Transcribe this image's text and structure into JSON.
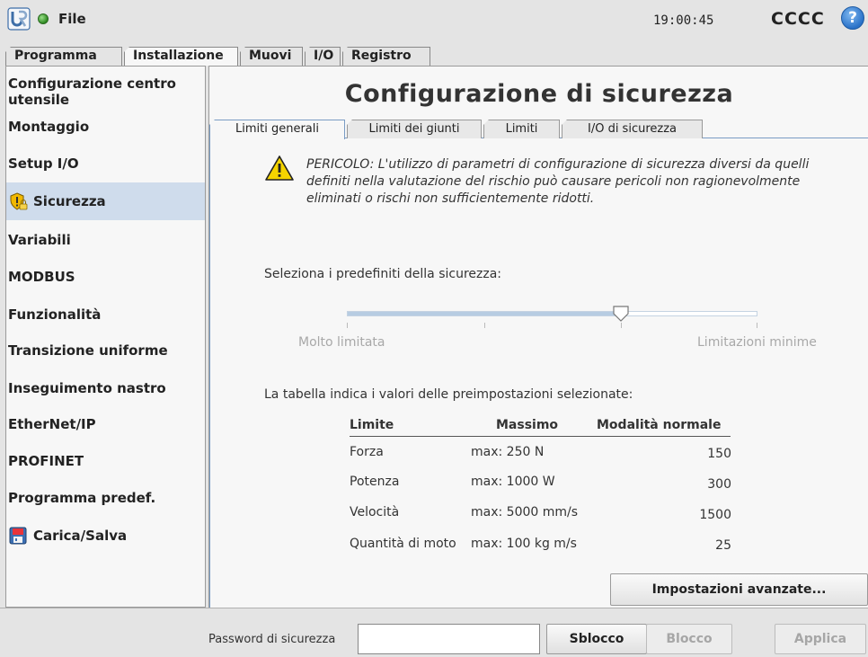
{
  "topbar": {
    "file_label": "File",
    "clock": "19:00:45",
    "robot_name": "CCCC",
    "help_label": "?"
  },
  "main_tabs": [
    {
      "label": "Programma"
    },
    {
      "label": "Installazione"
    },
    {
      "label": "Muovi"
    },
    {
      "label": "I/O"
    },
    {
      "label": "Registro"
    }
  ],
  "sidebar": {
    "items": [
      {
        "label": "Configurazione centro utensile"
      },
      {
        "label": "Montaggio"
      },
      {
        "label": "Setup I/O"
      },
      {
        "label": "Sicurezza"
      },
      {
        "label": "Variabili"
      },
      {
        "label": "MODBUS"
      },
      {
        "label": "Funzionalità"
      },
      {
        "label": "Transizione uniforme"
      },
      {
        "label": "Inseguimento nastro"
      },
      {
        "label": "EtherNet/IP"
      },
      {
        "label": "PROFINET"
      },
      {
        "label": "Programma predef."
      },
      {
        "label": "Carica/Salva"
      }
    ]
  },
  "page": {
    "title": "Configurazione di sicurezza",
    "subtabs": [
      {
        "label": "Limiti generali"
      },
      {
        "label": "Limiti dei giunti"
      },
      {
        "label": "Limiti"
      },
      {
        "label": "I/O di sicurezza"
      }
    ],
    "warning": "PERICOLO: L'utilizzo di parametri di configurazione di sicurezza diversi da quelli definiti nella valutazione del rischio può causare pericoli non ragionevolmente eliminati o rischi non sufficientemente ridotti.",
    "preset_label": "Seleziona i predefiniti della sicurezza:",
    "slider": {
      "min_label": "Molto limitata",
      "max_label": "Limitazioni minime",
      "value_fraction": 0.667
    },
    "table_note": "La tabella indica i valori delle preimpostazioni selezionate:",
    "table": {
      "headers": {
        "limit": "Limite",
        "max": "Massimo",
        "normal": "Modalità normale"
      },
      "rows": [
        {
          "limit": "Forza",
          "max": "max: 250 N",
          "normal": "150"
        },
        {
          "limit": "Potenza",
          "max": "max: 1000 W",
          "normal": "300"
        },
        {
          "limit": "Velocità",
          "max": "max: 5000 mm/s",
          "normal": "1500"
        },
        {
          "limit": "Quantità di moto",
          "max": "max: 100 kg m/s",
          "normal": "25"
        }
      ]
    },
    "advanced_button": "Impostazioni avanzate..."
  },
  "bottombar": {
    "password_label": "Password di sicurezza",
    "password_value": "",
    "unlock_label": "Sblocco",
    "lock_label": "Blocco",
    "apply_label": "Applica"
  },
  "colors": {
    "accent": "#2a72c8",
    "selected_row": "#cfdcec",
    "warning": "#f5d400"
  }
}
